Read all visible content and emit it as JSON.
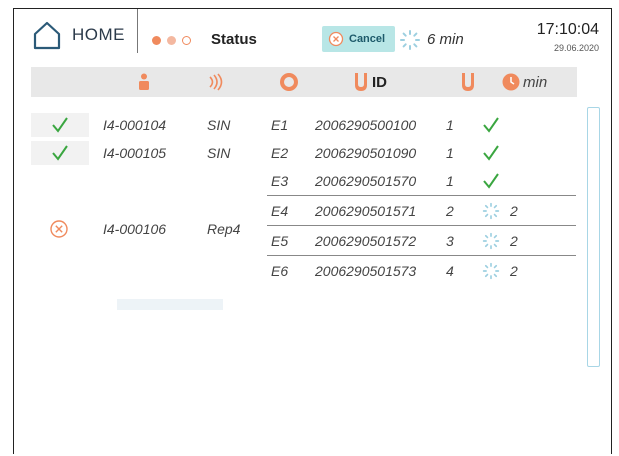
{
  "header": {
    "home_label": "HOME",
    "status_label": "Status",
    "cancel_label": "Cancel",
    "eta": "6 min",
    "time": "17:10:04",
    "date": "29.06.2020",
    "dot_colors": [
      "#f08a5d",
      "#f4b8a0",
      "#ffffff"
    ]
  },
  "columns": {
    "id_label": "ID",
    "min_label": "min",
    "icons": [
      "person-icon",
      "signal-icon",
      "ring-icon",
      "tube-icon",
      "tube-icon",
      "clock-icon"
    ]
  },
  "rows": [
    {
      "status": "check",
      "sample": "I4-000104",
      "method": "SIN",
      "pos": "E1",
      "id": "2006290500100",
      "count": "1",
      "state": "check",
      "min": ""
    },
    {
      "status": "check",
      "sample": "I4-000105",
      "method": "SIN",
      "pos": "E2",
      "id": "2006290501090",
      "count": "1",
      "state": "check",
      "min": ""
    },
    {
      "status": "",
      "sample": "",
      "method": "",
      "pos": "E3",
      "id": "2006290501570",
      "count": "1",
      "state": "check",
      "min": ""
    },
    {
      "status": "",
      "sample": "",
      "method": "",
      "pos": "E4",
      "id": "2006290501571",
      "count": "2",
      "state": "spinner",
      "min": "2"
    },
    {
      "status": "cancelled",
      "sample": "I4-000106",
      "method": "Rep4",
      "pos": "E5",
      "id": "2006290501572",
      "count": "3",
      "state": "spinner",
      "min": "2"
    },
    {
      "status": "",
      "sample": "",
      "method": "",
      "pos": "E6",
      "id": "2006290501573",
      "count": "4",
      "state": "spinner",
      "min": "2"
    }
  ],
  "colors": {
    "accent_orange": "#f08a5d",
    "check_green": "#3aa640",
    "cancel_bg": "#b8e6e6",
    "header_bg": "#e8e8e8"
  }
}
